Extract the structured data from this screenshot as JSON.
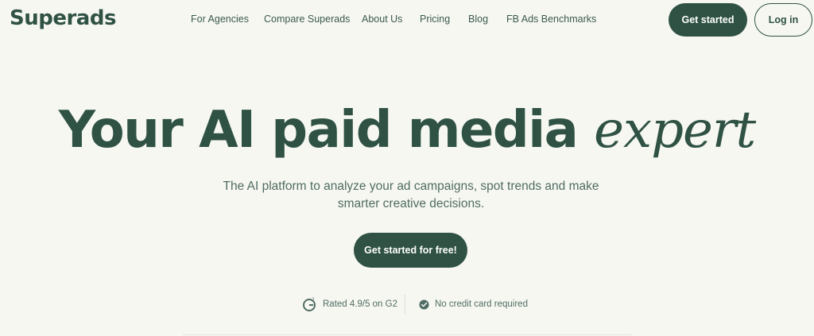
{
  "brand": {
    "logo_text": "Superads"
  },
  "nav": {
    "items": [
      {
        "label": "For Agencies"
      },
      {
        "label": "Compare Superads"
      },
      {
        "label": "About Us"
      },
      {
        "label": "Pricing"
      },
      {
        "label": "Blog"
      },
      {
        "label": "FB Ads Benchmarks"
      }
    ]
  },
  "header_actions": {
    "get_started": "Get started",
    "login": "Log in"
  },
  "hero": {
    "title_main": "Your AI paid media",
    "title_italic": "expert",
    "subtitle": "The AI platform to analyze your ad campaigns, spot trends and make smarter creative decisions.",
    "cta_label": "Get started for free!"
  },
  "trust": {
    "rating_text": "Rated 4.9/5 on G2",
    "rating_icon": "g2-icon",
    "no_cc_text": "No credit card required",
    "no_cc_icon": "check-badge-icon"
  },
  "colors": {
    "brand_green": "#2f5244",
    "background": "#f7f7f2",
    "muted_text": "#4f6d62"
  }
}
